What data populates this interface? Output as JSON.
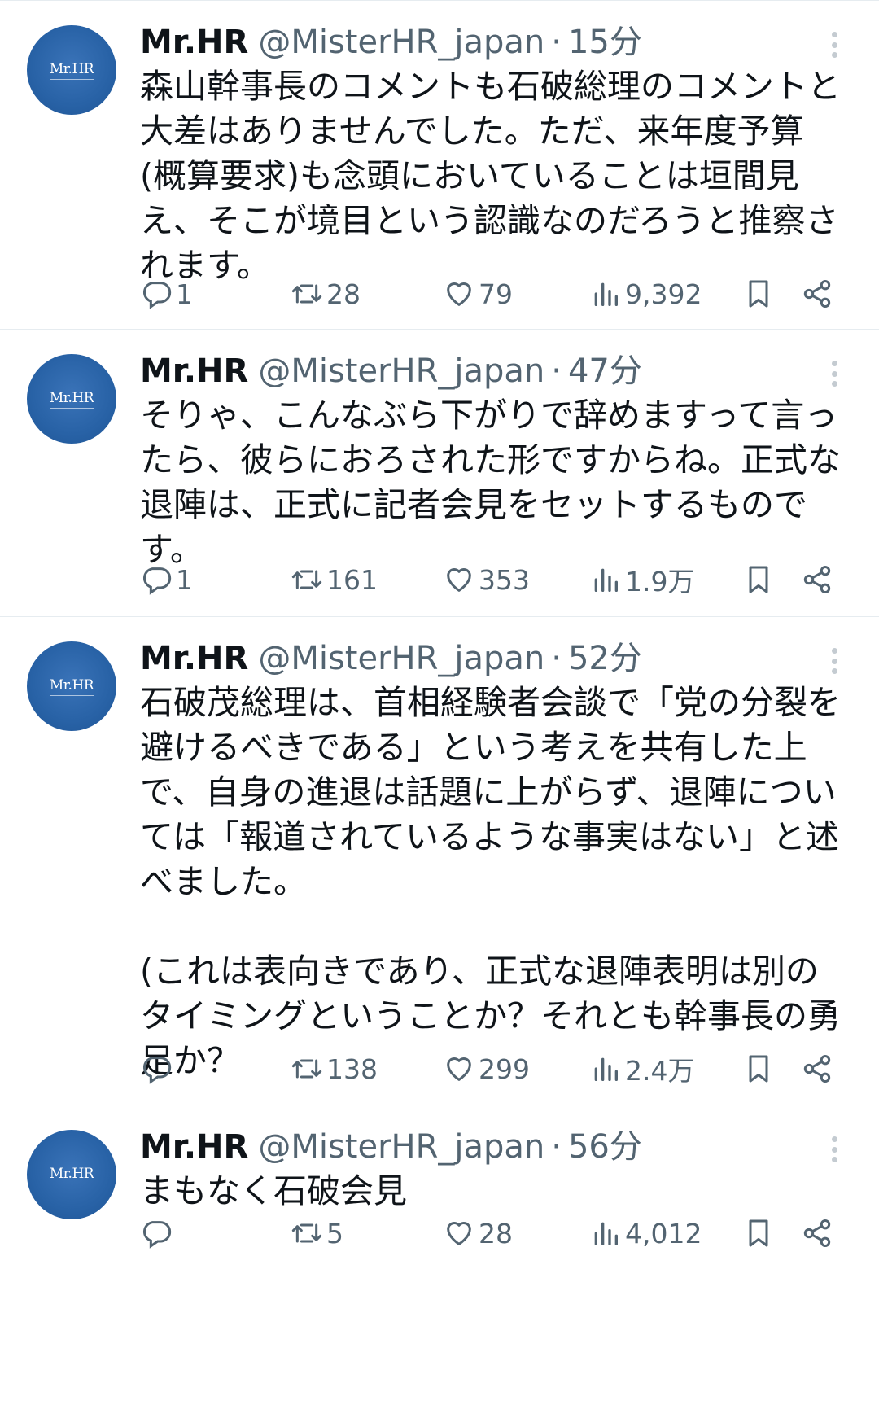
{
  "tweets": [
    {
      "avatar_text": "Mr.HR",
      "name": "Mr.HR",
      "handle": "@MisterHR_japan",
      "separator": "·",
      "time": "15分",
      "text": "森山幹事長のコメントも石破総理のコメントと大差はありませんでした。ただ、来年度予算(概算要求)も念頭においていることは垣間見え、そこが境目という認識なのだろうと推察されます。",
      "replies": "1",
      "retweets": "28",
      "likes": "79",
      "views": "9,392"
    },
    {
      "avatar_text": "Mr.HR",
      "name": "Mr.HR",
      "handle": "@MisterHR_japan",
      "separator": "·",
      "time": "47分",
      "text": "そりゃ、こんなぶら下がりで辞めますって言ったら、彼らにおろされた形ですからね。正式な退陣は、正式に記者会見をセットするものです。",
      "replies": "1",
      "retweets": "161",
      "likes": "353",
      "views": "1.9万"
    },
    {
      "avatar_text": "Mr.HR",
      "name": "Mr.HR",
      "handle": "@MisterHR_japan",
      "separator": "·",
      "time": "52分",
      "text": "石破茂総理は、首相経験者会談で「党の分裂を避けるべきである」という考えを共有した上で、自身の進退は話題に上がらず、退陣については「報道されているような事実はない」と述べました。\n\n(これは表向きであり、正式な退陣表明は別のタイミングということか？それとも幹事長の勇足か？",
      "replies": "",
      "retweets": "138",
      "likes": "299",
      "views": "2.4万"
    },
    {
      "avatar_text": "Mr.HR",
      "name": "Mr.HR",
      "handle": "@MisterHR_japan",
      "separator": "·",
      "time": "56分",
      "text": "まもなく石破会見",
      "replies": "",
      "retweets": "5",
      "likes": "28",
      "views": "4,012"
    }
  ],
  "icons": {
    "reply": "reply-icon",
    "retweet": "retweet-icon",
    "like": "heart-icon",
    "views": "views-chart-icon",
    "bookmark": "bookmark-icon",
    "share": "share-icon",
    "more": "more-vertical-icon"
  },
  "colors": {
    "text": "#0f1419",
    "secondary": "#536471",
    "avatar": "#2862a6",
    "divider": "#e6ecf0"
  }
}
